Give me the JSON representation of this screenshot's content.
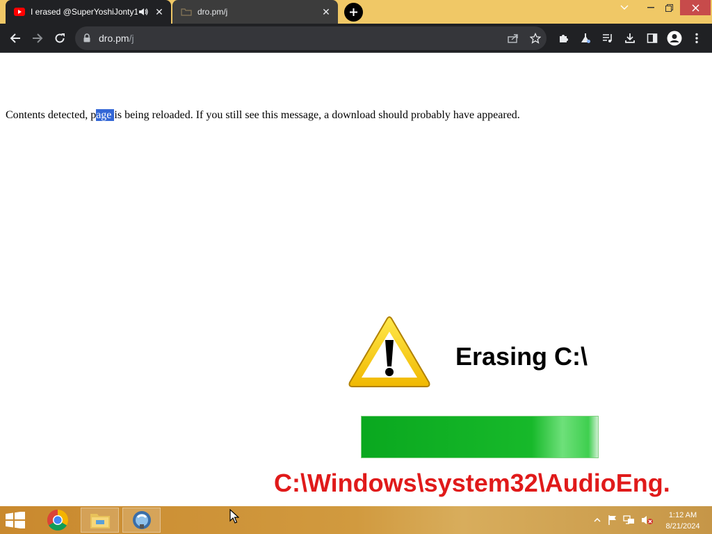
{
  "browser": {
    "tabs": [
      {
        "title": "I erased @SuperYoshiJonty1",
        "active": true,
        "favicon": "youtube-icon",
        "audio": "speaker-icon"
      },
      {
        "title": "dro.pm/j",
        "active": false,
        "favicon": "page-icon"
      }
    ],
    "address": {
      "host": "dro.pm",
      "path": "/j"
    }
  },
  "page": {
    "message": {
      "before": "Contents detected, p",
      "selected": "age ",
      "after": "is being reloaded. If you still see this message, a download should probably have appeared."
    },
    "erasing_text": "Erasing C:\\",
    "progress": 1.0,
    "filepath": "C:\\Windows\\system32\\AudioEng."
  },
  "taskbar": {
    "clock_time": "1:12 AM",
    "clock_date": "8/21/2024"
  },
  "colors": {
    "titlebar": "#f0c866",
    "toolbar": "#202124",
    "progress_green": "#17b92a",
    "filepath_red": "#e01a1a",
    "selection": "#3367d6"
  }
}
